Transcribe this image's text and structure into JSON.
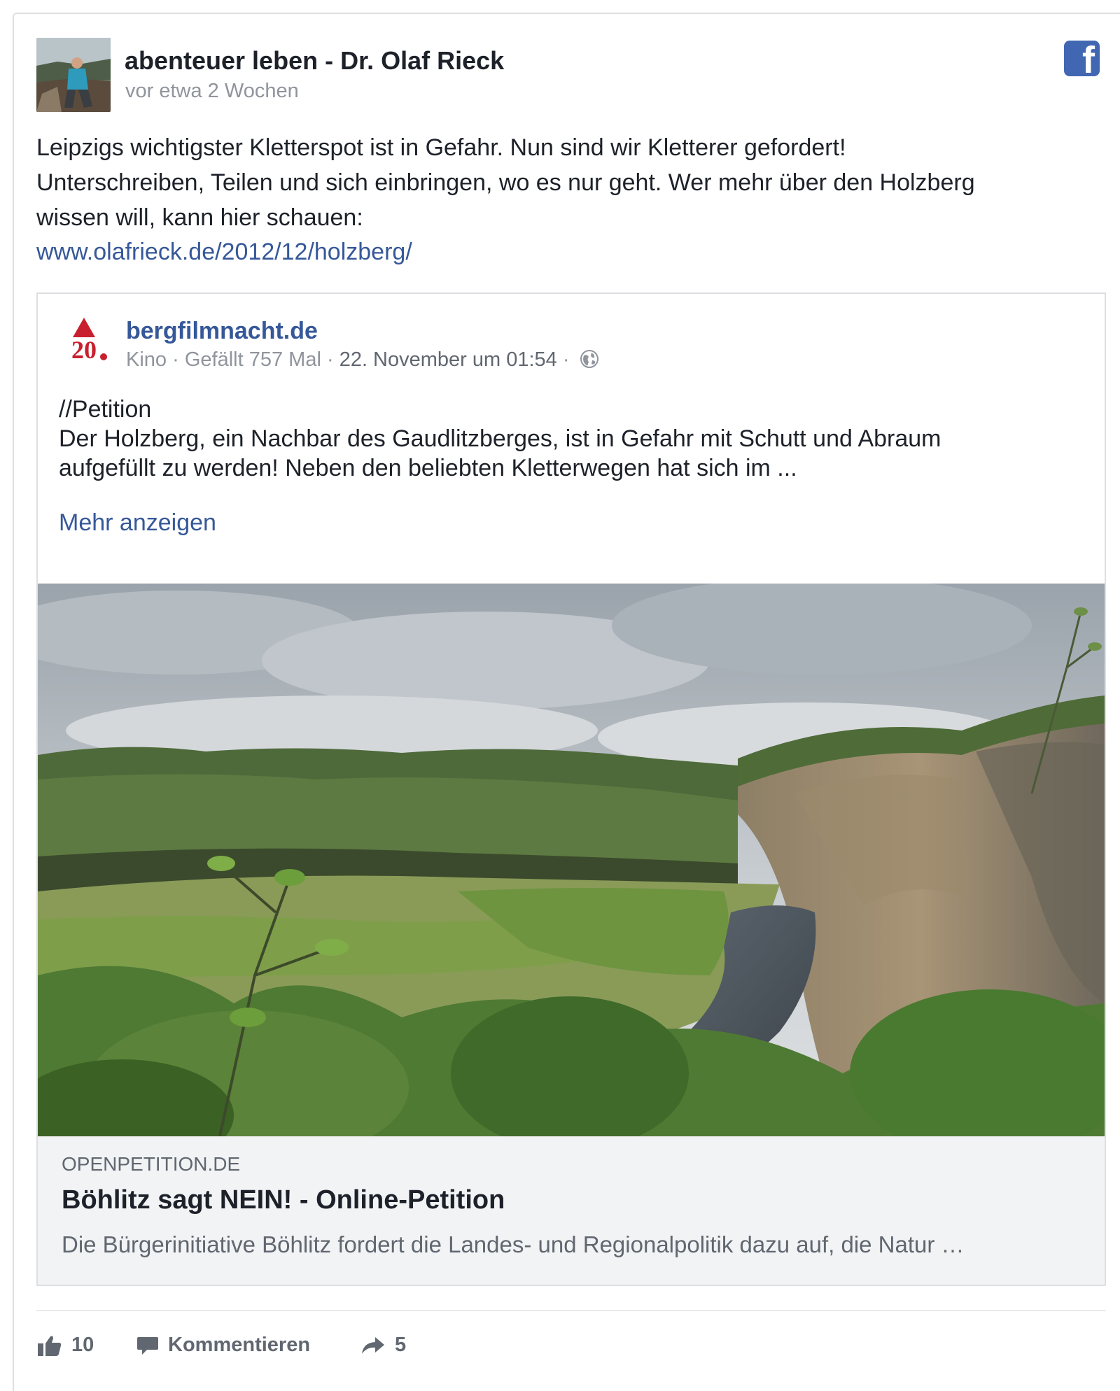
{
  "post": {
    "author": "abenteuer leben - Dr. Olaf Rieck",
    "time": "vor etwa 2 Wochen",
    "text_lines": [
      "Leipzigs wichtigster Kletterspot ist in Gefahr. Nun sind wir Kletterer gefordert!",
      "Unterschreiben, Teilen und sich einbringen, wo es nur geht. Wer mehr über den Holzberg",
      "wissen will, kann hier schauen:"
    ],
    "link": "www.olafrieck.de/2012/12/holzberg/"
  },
  "shared": {
    "page_name": "bergfilmnacht.de",
    "logo_text": "20",
    "category": "Kino",
    "likes": "Gefällt 757 Mal",
    "date": "22. November um 01:54",
    "separator": "·",
    "text_lines": [
      "//Petition",
      "Der Holzberg, ein Nachbar des Gaudlitzberges, ist in Gefahr mit Schutt und Abraum",
      "aufgefüllt zu werden! Neben den beliebten Kletterwegen hat sich im ..."
    ],
    "more_label": "Mehr anzeigen",
    "link_domain": "OPENPETITION.DE",
    "link_title": "Böhlitz sagt NEIN! - Online-Petition",
    "link_desc": "Die Bürgerinitiative Böhlitz fordert die Landes- und Regionalpolitik dazu auf, die Natur …"
  },
  "actions": {
    "like_count": "10",
    "comment_label": "Kommentieren",
    "share_count": "5"
  },
  "colors": {
    "link": "#365899",
    "facebook": "#4267b2",
    "muted": "#90949c",
    "text": "#1d2129"
  },
  "icons": [
    "facebook-icon",
    "globe-icon",
    "like-icon",
    "comment-icon",
    "share-icon"
  ]
}
